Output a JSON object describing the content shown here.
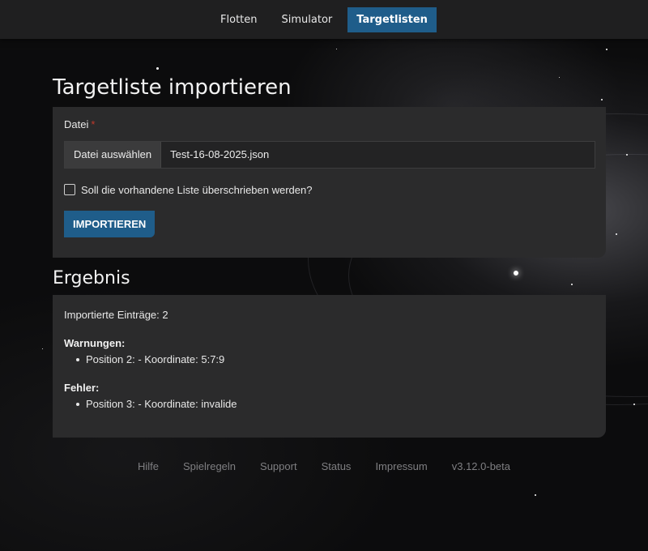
{
  "nav": {
    "items": [
      {
        "label": "Flotten",
        "active": false
      },
      {
        "label": "Simulator",
        "active": false
      },
      {
        "label": "Targetlisten",
        "active": true
      }
    ]
  },
  "import_section": {
    "title": "Targetliste importieren",
    "file_label": "Datei",
    "required_mark": "*",
    "file_button_label": "Datei auswählen",
    "file_name": "Test-16-08-2025.json",
    "overwrite_label": "Soll die vorhandene Liste überschrieben werden?",
    "overwrite_checked": false,
    "import_button_label": "IMPORTIEREN"
  },
  "result_section": {
    "title": "Ergebnis",
    "imported_text": "Importierte Einträge: 2",
    "warnings_title": "Warnungen:",
    "warnings": [
      "Position 2: - Koordinate: 5:7:9"
    ],
    "errors_title": "Fehler:",
    "errors": [
      "Position 3: - Koordinate: invalide"
    ]
  },
  "footer": {
    "links": [
      "Hilfe",
      "Spielregeln",
      "Support",
      "Status",
      "Impressum"
    ],
    "version": "v3.12.0-beta"
  },
  "colors": {
    "accent": "#1f5d8a",
    "panel": "#2b2b2c",
    "nav_bg": "#1f1f20",
    "required": "#c0392b"
  }
}
